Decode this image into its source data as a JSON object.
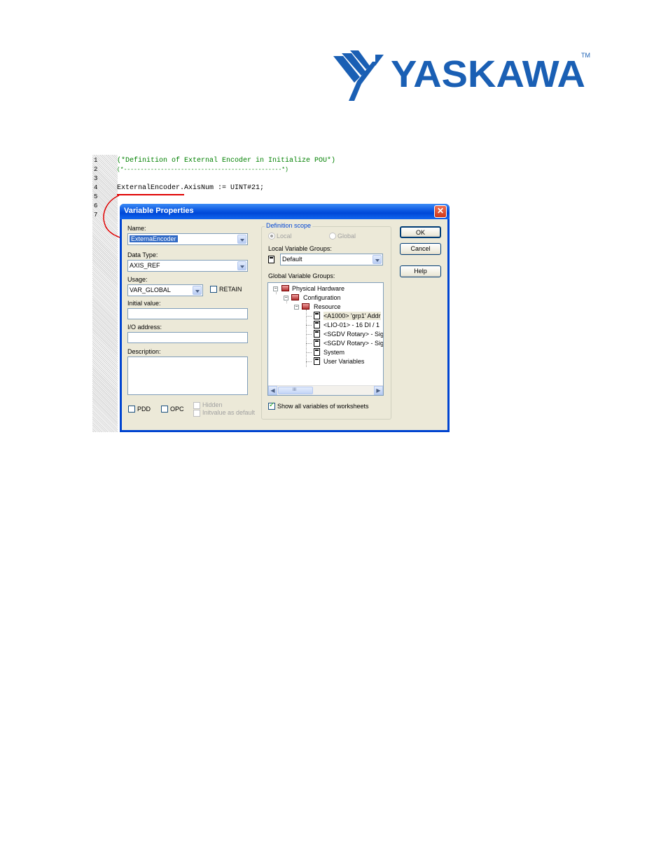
{
  "logo": {
    "text": "YASKAWA",
    "tm": "TM"
  },
  "code_editor": {
    "line_numbers": [
      "1",
      "2",
      "3",
      "4",
      "5",
      "6",
      "7"
    ],
    "line1": "(*Definition of External Encoder in Initialize POU*)",
    "line2": "(*-----------------------------------------------*)",
    "line4": "ExternalEncoder.AxisNum := UINT#21;"
  },
  "dialog": {
    "title": "Variable Properties",
    "close_glyph": "✕",
    "name_label": "Name:",
    "name_value": "ExternaEncoder",
    "data_type_label": "Data Type:",
    "data_type_value": "AXIS_REF",
    "usage_label": "Usage:",
    "usage_value": "VAR_GLOBAL",
    "retain_label": "RETAIN",
    "initial_value_label": "Initial value:",
    "io_address_label": "I/O address:",
    "description_label": "Description:",
    "pdd_label": "PDD",
    "opc_label": "OPC",
    "hidden_label": "Hidden",
    "initvalue_default_label": "Initvalue as default",
    "definition_scope_label": "Definition scope",
    "local_label": "Local",
    "global_label": "Global",
    "local_groups_label": "Local Variable Groups:",
    "local_groups_value": "Default",
    "global_groups_label": "Global Variable Groups:",
    "tree": [
      "Physical Hardware",
      "Configuration",
      "Resource",
      "<A1000> 'grp1' Addr",
      "<LIO-01> - 16 DI / 1",
      "<SGDV Rotary> - Sig",
      "<SGDV Rotary> - Sig",
      "System",
      "User Variables"
    ],
    "scroll_mid": "III",
    "show_all_label": "Show all variables of worksheets",
    "ok_label": "OK",
    "cancel_label": "Cancel",
    "help_label": "Help"
  }
}
